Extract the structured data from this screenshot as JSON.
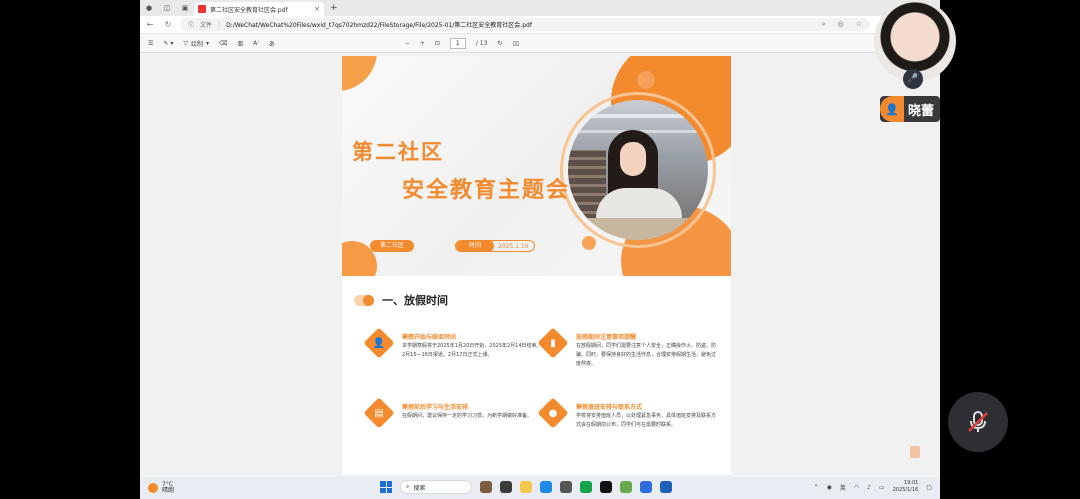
{
  "tabbar": {
    "tab_title": "第二社区安全教育社区会.pdf",
    "tab_close": "×",
    "new_tab": "+"
  },
  "addressbar": {
    "back": "←",
    "refresh": "↻",
    "file_label": "文件",
    "path": "D:/WeChat/WeChat%20Files/wxid_t7qs702hmzd22/FileStorage/File/2025-01/第二社区安全教育社区会.pdf"
  },
  "pdf_toolbar": {
    "draw_label": "绘制",
    "page_current": "1",
    "page_total": "/ 13",
    "zoom_out": "−",
    "zoom_in": "+"
  },
  "cover": {
    "title_line1": "第二社区",
    "title_line2": "安全教育主题会",
    "pill_left": "第二社区",
    "pill_time_label": "时间",
    "pill_time_value": "2025.1.16"
  },
  "section": {
    "heading": "一、放假时间",
    "items": [
      {
        "title": "寒假开始与结束时间",
        "body": "本学期寒假将于2025年1月20日开始，2025年2月14日结束。2月15—16日报道，2月17日正式上课。"
      },
      {
        "title": "放假期间注意事项提醒",
        "body": "在放假期间，同学们需要注意个人安全，正确操作火、防盗、防骗。同时，要保持良好的生活作息，合理安排假期生活，避免过度熬夜。"
      },
      {
        "title": "寒假前后学习与生活安排",
        "body": "在假期间，建议保持一定的学习习惯，为新学期做好准备。"
      },
      {
        "title": "寒假值班安排与联系方式",
        "body": "学校将安排值班人员，以处理紧急事务。具体值班安排及联系方式会在假期前公布，同学们可在需要时联系。"
      }
    ]
  },
  "taskbar": {
    "weather_temp": "7°C",
    "weather_desc": "晴朗",
    "search_placeholder": "搜索",
    "tray_lang": "英",
    "time": "19:01",
    "date": "2025/1/16"
  },
  "overlay": {
    "participant_name": "晓蕾"
  },
  "colors": {
    "accent": "#f38a2e",
    "taskbar": "#e9edf3"
  }
}
